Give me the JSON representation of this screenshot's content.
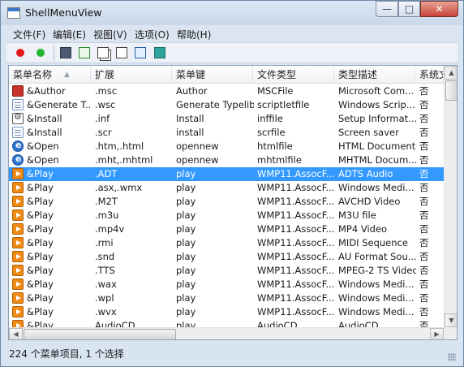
{
  "window": {
    "title": "ShellMenuView",
    "controls": {
      "minimize": "—",
      "maximize": "□",
      "close": "✕"
    }
  },
  "menubar": {
    "items": [
      "文件(F)",
      "编辑(E)",
      "视图(V)",
      "选项(O)",
      "帮助(H)"
    ]
  },
  "toolbar": {
    "buttons": [
      {
        "icon": "red-circle-icon",
        "color": "#e3191c"
      },
      {
        "icon": "green-circle-icon",
        "color": "#21b52f"
      },
      {
        "icon": "save-icon"
      },
      {
        "icon": "refresh-icon"
      },
      {
        "icon": "copy-icon"
      },
      {
        "icon": "properties-icon"
      },
      {
        "icon": "find-icon"
      },
      {
        "icon": "exit-icon"
      }
    ]
  },
  "list": {
    "columns": [
      "菜单名称",
      "扩展",
      "菜单键",
      "文件类型",
      "类型描述",
      "系统文"
    ],
    "rows": [
      {
        "icon": "author",
        "name": "&Author",
        "ext": ".msc",
        "key": "Author",
        "filetype": "MSCFile",
        "desc": "Microsoft Com...",
        "sys": "否"
      },
      {
        "icon": "doc",
        "name": "&Generate T...",
        "ext": ".wsc",
        "key": "Generate Typelib",
        "filetype": "scriptletfile",
        "desc": "Windows Scrip...",
        "sys": "否"
      },
      {
        "icon": "setup",
        "name": "&Install",
        "ext": ".inf",
        "key": "Install",
        "filetype": "inffile",
        "desc": "Setup Informat...",
        "sys": "否"
      },
      {
        "icon": "doc",
        "name": "&Install",
        "ext": ".scr",
        "key": "install",
        "filetype": "scrfile",
        "desc": "Screen saver",
        "sys": "否"
      },
      {
        "icon": "ie",
        "name": "&Open",
        "ext": ".htm,.html",
        "key": "opennew",
        "filetype": "htmlfile",
        "desc": "HTML Document",
        "sys": "否"
      },
      {
        "icon": "ie",
        "name": "&Open",
        "ext": ".mht,.mhtml",
        "key": "opennew",
        "filetype": "mhtmlfile",
        "desc": "MHTML Docum...",
        "sys": "否"
      },
      {
        "icon": "play",
        "name": "&Play",
        "ext": ".ADT",
        "key": "play",
        "filetype": "WMP11.AssocF...",
        "desc": "ADTS Audio",
        "sys": "否",
        "selected": true
      },
      {
        "icon": "play",
        "name": "&Play",
        "ext": ".asx,.wmx",
        "key": "play",
        "filetype": "WMP11.AssocF...",
        "desc": "Windows Medi...",
        "sys": "否"
      },
      {
        "icon": "play",
        "name": "&Play",
        "ext": ".M2T",
        "key": "play",
        "filetype": "WMP11.AssocF...",
        "desc": "AVCHD Video",
        "sys": "否"
      },
      {
        "icon": "play",
        "name": "&Play",
        "ext": ".m3u",
        "key": "play",
        "filetype": "WMP11.AssocF...",
        "desc": "M3U file",
        "sys": "否"
      },
      {
        "icon": "play",
        "name": "&Play",
        "ext": ".mp4v",
        "key": "play",
        "filetype": "WMP11.AssocF...",
        "desc": "MP4 Video",
        "sys": "否"
      },
      {
        "icon": "play",
        "name": "&Play",
        "ext": ".rmi",
        "key": "play",
        "filetype": "WMP11.AssocF...",
        "desc": "MIDI Sequence",
        "sys": "否"
      },
      {
        "icon": "play",
        "name": "&Play",
        "ext": ".snd",
        "key": "play",
        "filetype": "WMP11.AssocF...",
        "desc": "AU Format Sou...",
        "sys": "否"
      },
      {
        "icon": "play",
        "name": "&Play",
        "ext": ".TTS",
        "key": "play",
        "filetype": "WMP11.AssocF...",
        "desc": "MPEG-2 TS Video",
        "sys": "否"
      },
      {
        "icon": "play",
        "name": "&Play",
        "ext": ".wax",
        "key": "play",
        "filetype": "WMP11.AssocF...",
        "desc": "Windows Medi...",
        "sys": "否"
      },
      {
        "icon": "play",
        "name": "&Play",
        "ext": ".wpl",
        "key": "play",
        "filetype": "WMP11.AssocF...",
        "desc": "Windows Medi...",
        "sys": "否"
      },
      {
        "icon": "play",
        "name": "&Play",
        "ext": ".wvx",
        "key": "play",
        "filetype": "WMP11.AssocF...",
        "desc": "Windows Medi...",
        "sys": "否"
      },
      {
        "icon": "play",
        "name": "&Play",
        "ext": "AudioCD",
        "key": "play",
        "filetype": "AudioCD",
        "desc": "AudioCD",
        "sys": "否"
      }
    ]
  },
  "statusbar": {
    "text": "224 个菜单项目, 1 个选择"
  },
  "colors": {
    "selection": "#3399ff",
    "window_frame": "#d9e4f1"
  }
}
